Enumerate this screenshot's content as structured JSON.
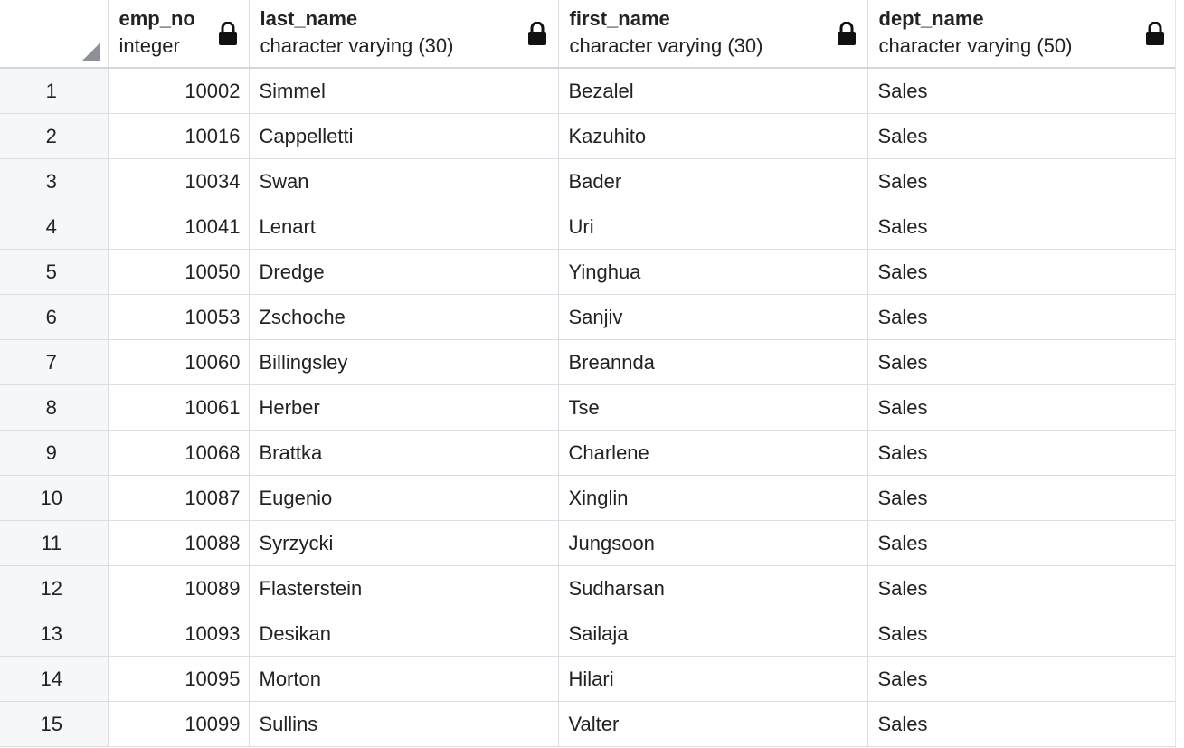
{
  "columns": [
    {
      "name": "emp_no",
      "type": "integer",
      "icon": "lock-icon"
    },
    {
      "name": "last_name",
      "type": "character varying (30)",
      "icon": "lock-icon"
    },
    {
      "name": "first_name",
      "type": "character varying (30)",
      "icon": "lock-icon"
    },
    {
      "name": "dept_name",
      "type": "character varying (50)",
      "icon": "lock-icon"
    }
  ],
  "rows": [
    {
      "num": "1",
      "emp_no": "10002",
      "last_name": "Simmel",
      "first_name": "Bezalel",
      "dept_name": "Sales"
    },
    {
      "num": "2",
      "emp_no": "10016",
      "last_name": "Cappelletti",
      "first_name": "Kazuhito",
      "dept_name": "Sales"
    },
    {
      "num": "3",
      "emp_no": "10034",
      "last_name": "Swan",
      "first_name": "Bader",
      "dept_name": "Sales"
    },
    {
      "num": "4",
      "emp_no": "10041",
      "last_name": "Lenart",
      "first_name": "Uri",
      "dept_name": "Sales"
    },
    {
      "num": "5",
      "emp_no": "10050",
      "last_name": "Dredge",
      "first_name": "Yinghua",
      "dept_name": "Sales"
    },
    {
      "num": "6",
      "emp_no": "10053",
      "last_name": "Zschoche",
      "first_name": "Sanjiv",
      "dept_name": "Sales"
    },
    {
      "num": "7",
      "emp_no": "10060",
      "last_name": "Billingsley",
      "first_name": "Breannda",
      "dept_name": "Sales"
    },
    {
      "num": "8",
      "emp_no": "10061",
      "last_name": "Herber",
      "first_name": "Tse",
      "dept_name": "Sales"
    },
    {
      "num": "9",
      "emp_no": "10068",
      "last_name": "Brattka",
      "first_name": "Charlene",
      "dept_name": "Sales"
    },
    {
      "num": "10",
      "emp_no": "10087",
      "last_name": "Eugenio",
      "first_name": "Xinglin",
      "dept_name": "Sales"
    },
    {
      "num": "11",
      "emp_no": "10088",
      "last_name": "Syrzycki",
      "first_name": "Jungsoon",
      "dept_name": "Sales"
    },
    {
      "num": "12",
      "emp_no": "10089",
      "last_name": "Flasterstein",
      "first_name": "Sudharsan",
      "dept_name": "Sales"
    },
    {
      "num": "13",
      "emp_no": "10093",
      "last_name": "Desikan",
      "first_name": "Sailaja",
      "dept_name": "Sales"
    },
    {
      "num": "14",
      "emp_no": "10095",
      "last_name": "Morton",
      "first_name": "Hilari",
      "dept_name": "Sales"
    },
    {
      "num": "15",
      "emp_no": "10099",
      "last_name": "Sullins",
      "first_name": "Valter",
      "dept_name": "Sales"
    }
  ],
  "colors": {
    "grid_line": "#dcdde3",
    "rownum_bg": "#f6f7f9",
    "text": "#222222",
    "corner_marker": "#8e9099"
  }
}
